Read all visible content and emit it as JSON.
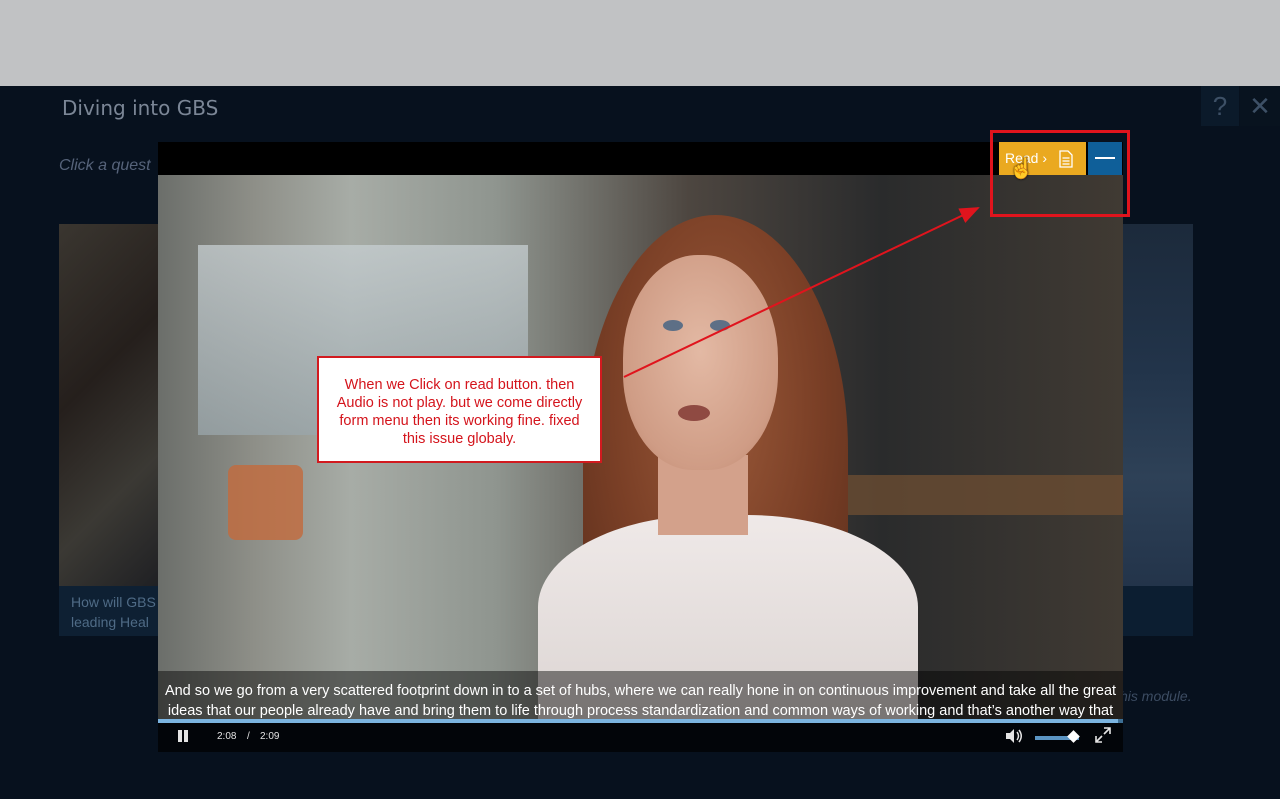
{
  "module": {
    "title": "Diving into GBS",
    "instruction": "Click a quest",
    "help_label": "?",
    "close_label": "✕",
    "tile_left_caption": "How will GBS\nleading Heal",
    "right_note": "his module."
  },
  "video": {
    "subtitle": "And so we go from a very scattered footprint down in to a set of hubs, where we can really hone in on continuous improvement and take all the great ideas that our people already have and bring them to life through process standardization and common ways of working and that’s another way that we can really help support the talent that we already have in the company.",
    "time_current": "2:08",
    "time_separator": "/",
    "time_total": "2:09",
    "progress": 0.995,
    "volume": 0.8
  },
  "read_panel": {
    "read_label": "Read ›",
    "read_icon": "document-icon",
    "minimize_icon": "minus-icon"
  },
  "annotation": {
    "text": "When we Click on read button. then Audio is not play. but we come directly form menu then its working fine. fixed this issue globaly.",
    "color": "#d4141c"
  }
}
